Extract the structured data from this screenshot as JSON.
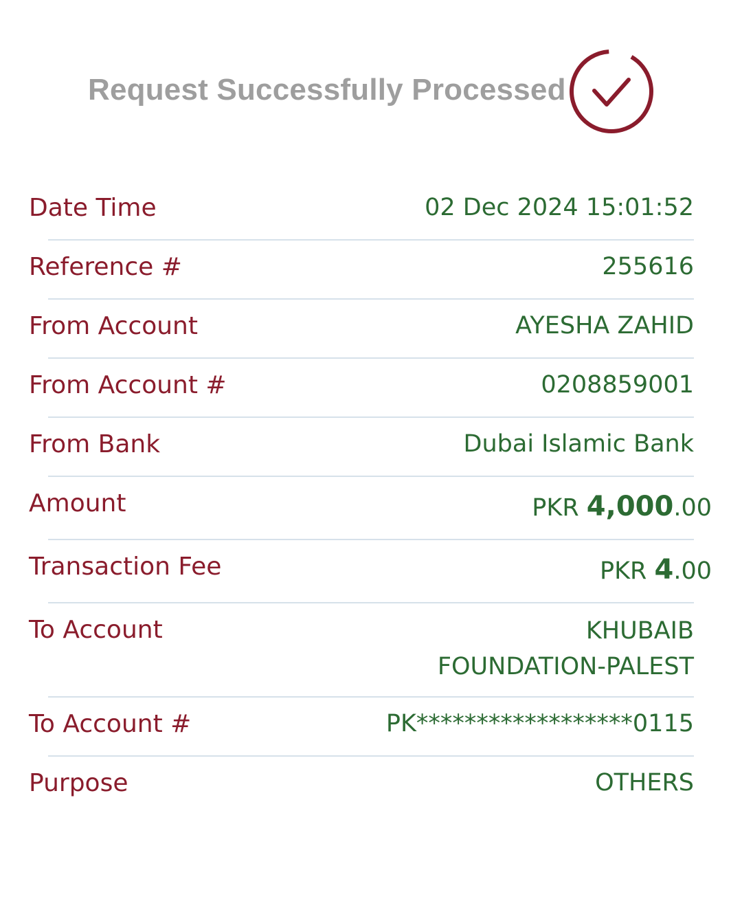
{
  "header": {
    "title": "Request Successfully Processed",
    "status_icon": "check-circle-icon",
    "icon_color": "#8a1c2c"
  },
  "details": {
    "date_time": {
      "label": "Date Time",
      "value": "02 Dec 2024 15:01:52"
    },
    "reference": {
      "label": "Reference #",
      "value": "255616"
    },
    "from_account": {
      "label": "From Account",
      "value": "AYESHA ZAHID"
    },
    "from_account_no": {
      "label": "From Account #",
      "value": "0208859001"
    },
    "from_bank": {
      "label": "From Bank",
      "value": "Dubai Islamic Bank"
    },
    "amount": {
      "label": "Amount",
      "currency": "PKR ",
      "integer": "4,000",
      "decimal": ".00"
    },
    "fee": {
      "label": "Transaction Fee",
      "currency": "PKR ",
      "integer": "4",
      "decimal": ".00"
    },
    "to_account": {
      "label": "To Account",
      "line1": "KHUBAIB",
      "line2": "FOUNDATION-PALEST"
    },
    "to_account_no": {
      "label": "To Account #",
      "value": "PK******************0115"
    },
    "purpose": {
      "label": "Purpose",
      "value": "OTHERS"
    }
  },
  "colors": {
    "label": "#8a1c2c",
    "value": "#2c6b33",
    "title": "#9e9e9e",
    "divider": "#d6e1ea"
  }
}
